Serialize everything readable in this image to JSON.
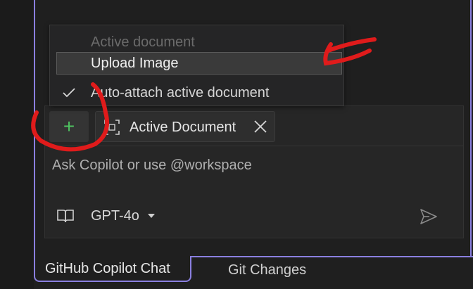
{
  "menu": {
    "items": [
      {
        "label": "Active document",
        "state": "disabled"
      },
      {
        "label": "Upload Image",
        "state": "highlighted"
      },
      {
        "label": "Auto-attach active document",
        "state": "checked"
      }
    ]
  },
  "attach": {
    "add_button_icon": "plus-icon",
    "chip_label": "Active Document",
    "chip_icon": "focus-frame-icon",
    "chip_close_icon": "close-icon"
  },
  "input": {
    "placeholder": "Ask Copilot or use @workspace"
  },
  "footer": {
    "model_label": "GPT-4o",
    "model_icon": "book-icon",
    "send_icon": "send-icon"
  },
  "tabs": [
    {
      "label": "GitHub Copilot Chat",
      "active": true
    },
    {
      "label": "Git Changes",
      "active": false
    }
  ],
  "colors": {
    "background": "#1f1f1f",
    "panel_border": "#8a7fe0",
    "plus_green": "#4ec260",
    "annotation_red": "#e01b1b"
  }
}
